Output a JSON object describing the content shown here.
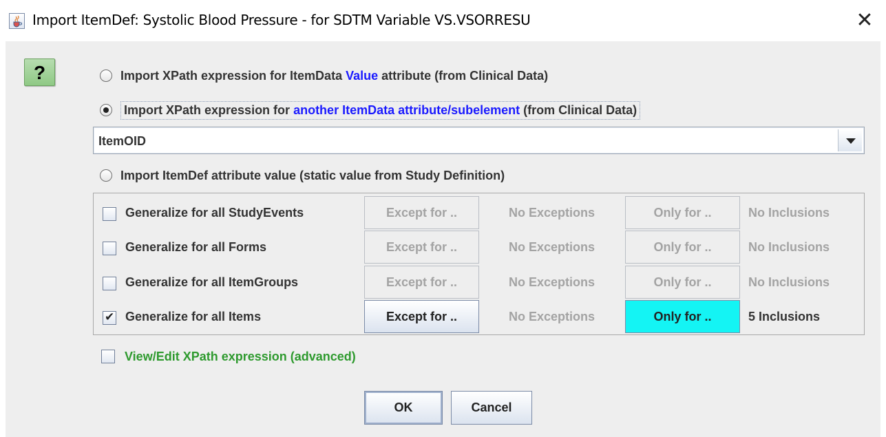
{
  "window": {
    "title": "Import ItemDef: Systolic Blood Pressure - for SDTM Variable VS.VSORRESU",
    "close_glyph": "✕",
    "app_icon": "java-cup-icon"
  },
  "help": {
    "label": "?"
  },
  "import_options": [
    {
      "before": "Import XPath expression for ItemData ",
      "highlight": "Value",
      "after": " attribute (from Clinical Data)",
      "selected": false
    },
    {
      "before": "Import XPath expression for ",
      "highlight": "another ItemData attribute/subelement",
      "after": " (from Clinical Data)",
      "selected": true
    },
    {
      "text": "Import ItemDef attribute value (static value from Study Definition)",
      "selected": false
    }
  ],
  "attribute_select": {
    "value": "ItemOID"
  },
  "generalize": {
    "rows": [
      {
        "label": "Generalize for all StudyEvents",
        "checked": false,
        "except": "Except for ..",
        "exceptions": "No Exceptions",
        "only": "Only for ..",
        "inclusions": "No Inclusions"
      },
      {
        "label": "Generalize for all Forms",
        "checked": false,
        "except": "Except for ..",
        "exceptions": "No Exceptions",
        "only": "Only for ..",
        "inclusions": "No Inclusions"
      },
      {
        "label": "Generalize for all ItemGroups",
        "checked": false,
        "except": "Except for ..",
        "exceptions": "No Exceptions",
        "only": "Only for ..",
        "inclusions": "No Inclusions"
      },
      {
        "label": "Generalize for all Items",
        "checked": true,
        "except": "Except for ..",
        "exceptions": "No Exceptions",
        "only": "Only for ..",
        "inclusions": "5 Inclusions"
      }
    ]
  },
  "advanced": {
    "label": "View/Edit XPath expression (advanced)",
    "checked": false
  },
  "actions": {
    "ok": "OK",
    "cancel": "Cancel"
  },
  "colors": {
    "highlight_blue": "#1a1aff",
    "advanced_green": "#2e9a2e",
    "only_for_active": "#14f4f4",
    "panel_bg": "#eeeeee"
  }
}
